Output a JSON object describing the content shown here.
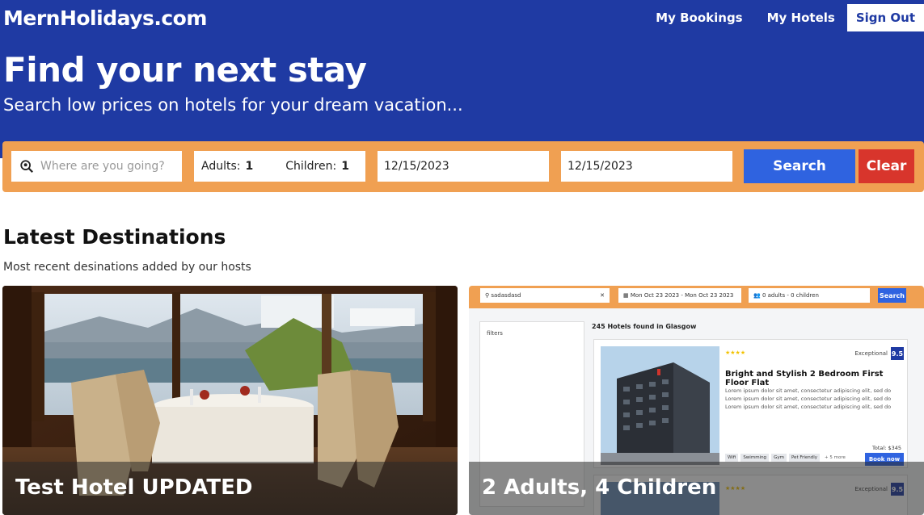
{
  "header": {
    "logo": "MernHolidays.com",
    "nav": {
      "bookings": "My Bookings",
      "hotels": "My Hotels",
      "signout": "Sign Out"
    },
    "hero_title": "Find your next stay",
    "hero_subtitle": "Search low prices on hotels for your dream vacation..."
  },
  "search": {
    "destination_placeholder": "Where are you going?",
    "adults_label": "Adults:",
    "adults_value": "1",
    "children_label": "Children:",
    "children_value": "1",
    "check_in": "12/15/2023",
    "check_out": "12/15/2023",
    "search_button": "Search",
    "clear_button": "Clear"
  },
  "section": {
    "title": "Latest Destinations",
    "subtitle": "Most recent desinations added by our hosts"
  },
  "cards": [
    {
      "name": "Test Hotel UPDATED"
    },
    {
      "name": "2 Adults, 4 Children"
    }
  ],
  "preview": {
    "destination": "sadasdasd",
    "dates": "Mon Oct 23 2023 - Mon Oct 23 2023",
    "guests": "0 adults - 0 children",
    "search": "Search",
    "filters": "filters",
    "count": "245 Hotels found in Glasgow",
    "stars": "★★★★",
    "rating_label": "Exceptional",
    "rating": "9.5",
    "hotel_name": "Bright and Stylish 2 Bedroom First Floor Flat",
    "description": "Lorem ipsum dolor sit amet, consectetur adipiscing elit, sed do Lorem ipsum dolor sit amet, consectetur adipiscing elit, sed do Lorem ipsum dolor sit amet, consectetur adipiscing elit, sed do",
    "tags": [
      "Wifi",
      "Swimming",
      "Gym",
      "Pet Friendly"
    ],
    "more": "+ 5 more",
    "total": "Total: $345",
    "book": "Book now"
  },
  "colors": {
    "header_bg": "#1f3aa3",
    "search_bar_bg": "#f0a052",
    "search_button": "#2f63e0",
    "clear_button": "#d8352c"
  }
}
